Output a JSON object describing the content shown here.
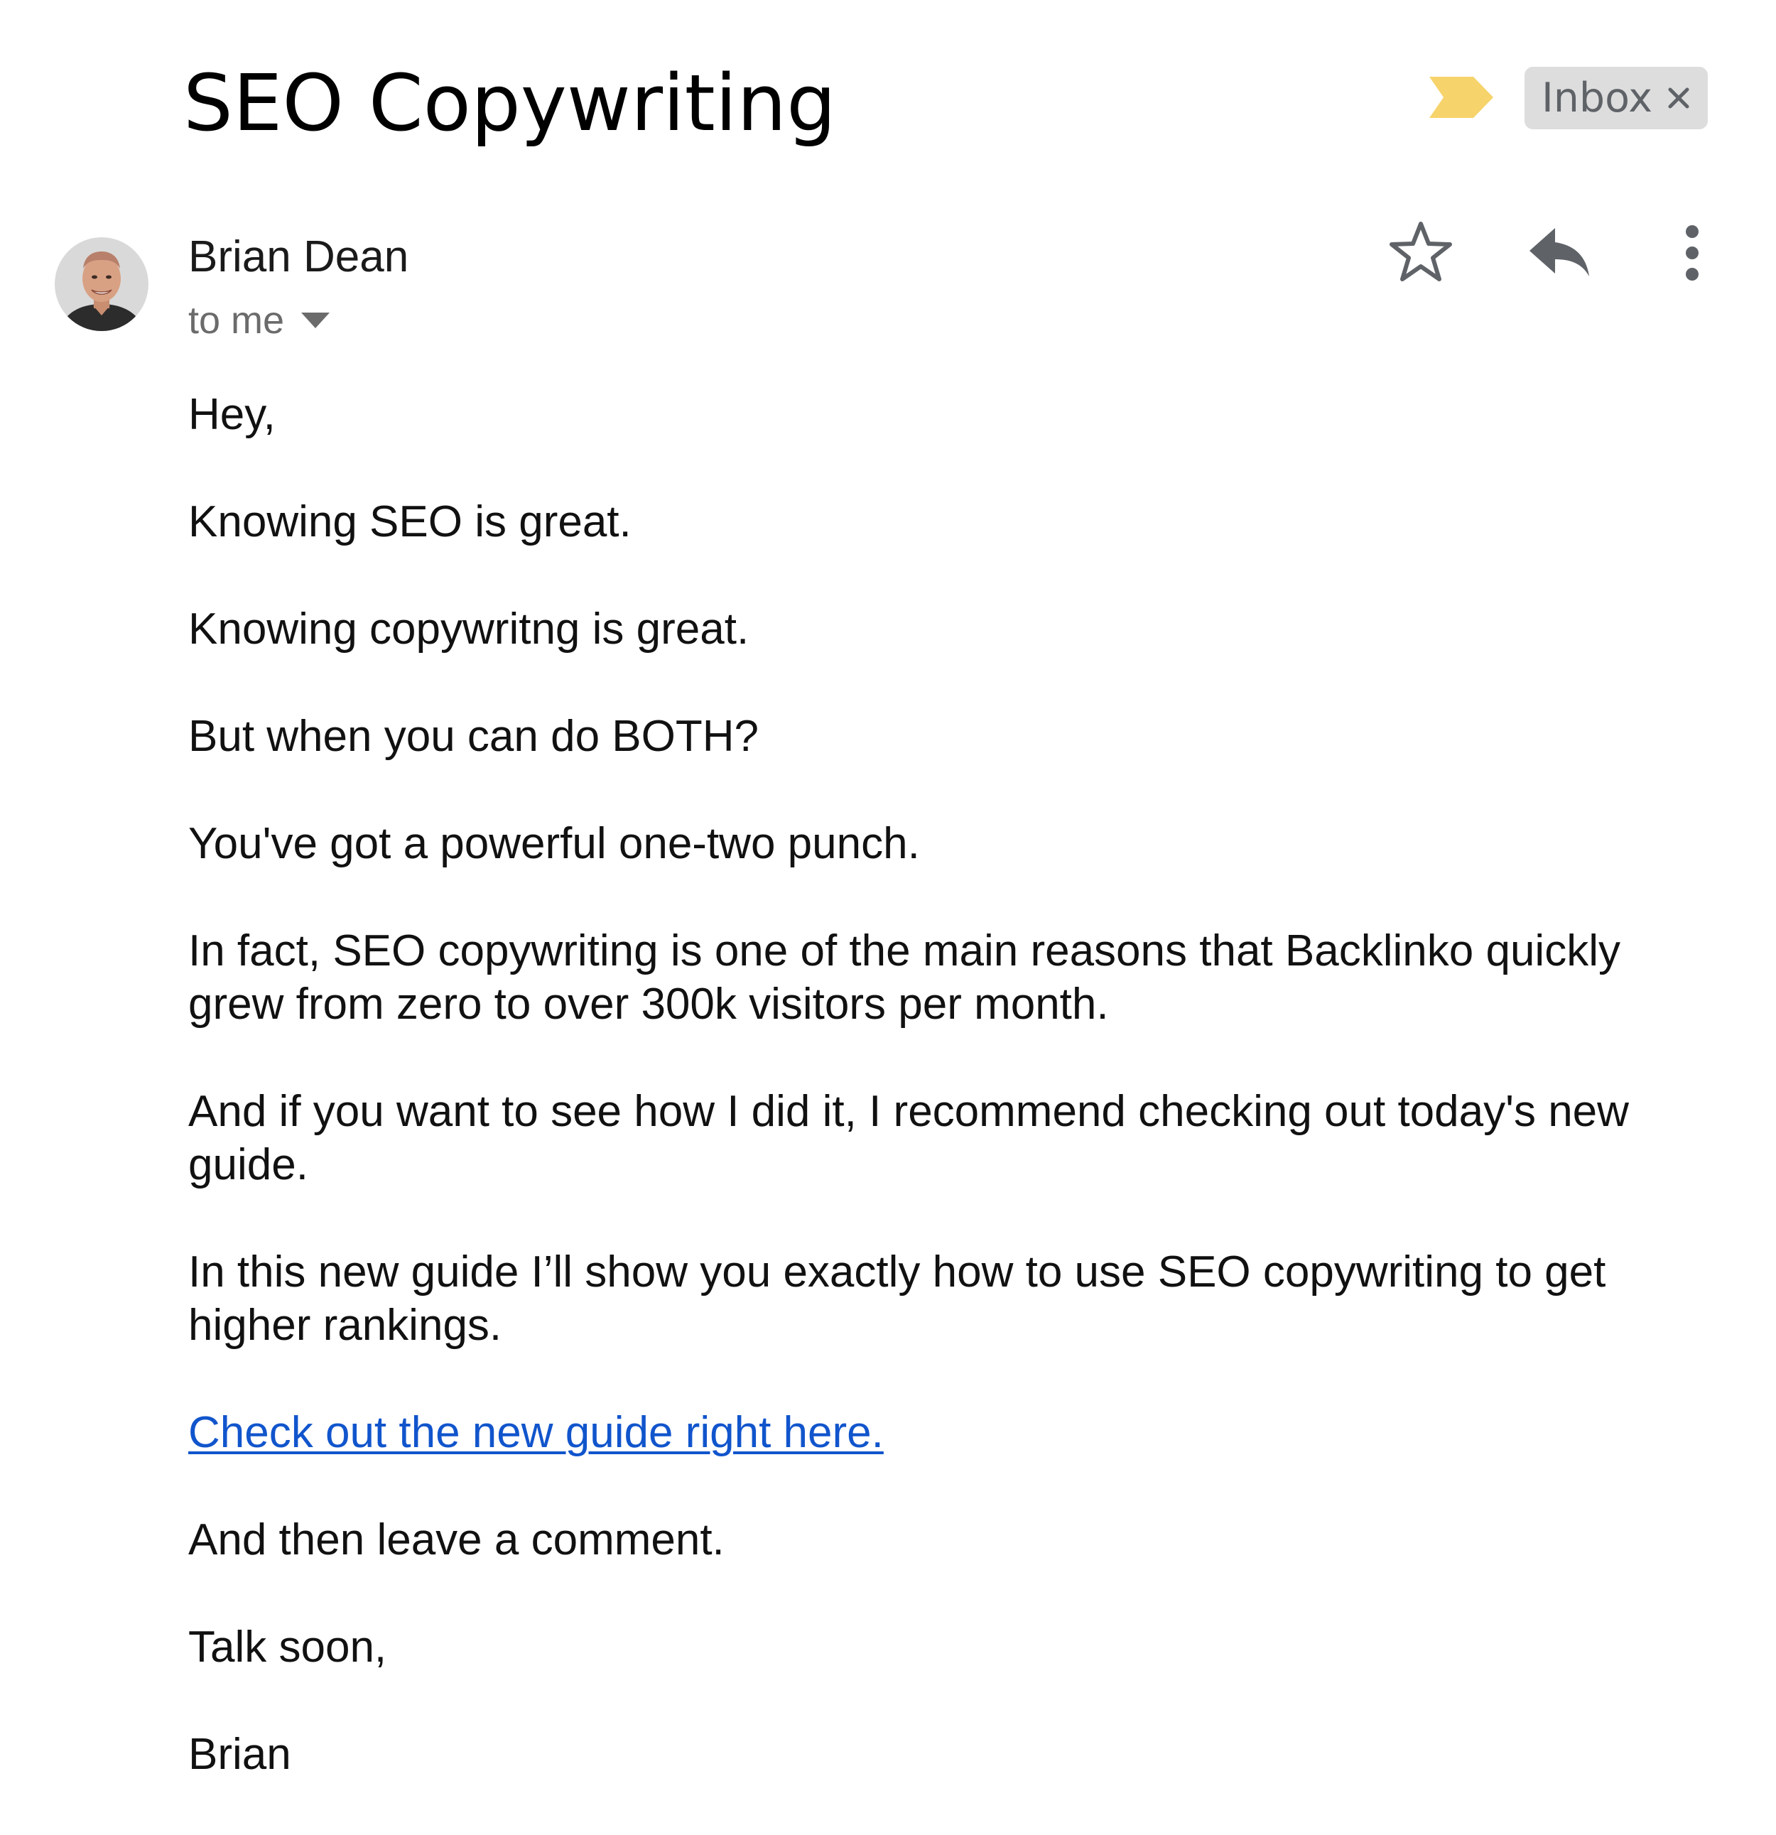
{
  "email": {
    "subject": "SEO Copywriting",
    "label": "Inbox",
    "label_remove_symbol": "×",
    "important_marker_color": "#f6d36b",
    "sender": {
      "name": "Brian Dean",
      "recipients": "to me"
    },
    "body": {
      "greeting": "Hey,",
      "paragraphs": [
        "Knowing SEO is great.",
        "Knowing copywritng is great.",
        "But when you can do BOTH?",
        "You've got a powerful one-two punch.",
        "In fact, SEO copywriting is one of the main reasons that Backlinko quickly grew from zero to over 300k visitors per month.",
        "And if you want to see how I did it, I recommend checking out today's new guide.",
        "In this new guide I’ll show you exactly how to use SEO copywriting to get higher rankings."
      ],
      "link_text": "Check out the new guide right here.",
      "after_link": "And then leave a comment.",
      "signoff": "Talk soon,",
      "signature": "Brian"
    },
    "icons": {
      "star": "star-outline-icon",
      "reply": "reply-icon",
      "more": "more-vert-icon",
      "caret": "caret-down-icon",
      "important": "important-marker-icon"
    },
    "colors": {
      "link": "#1155cc",
      "muted": "#6b6b6b",
      "chip_bg": "#dddddd"
    }
  }
}
